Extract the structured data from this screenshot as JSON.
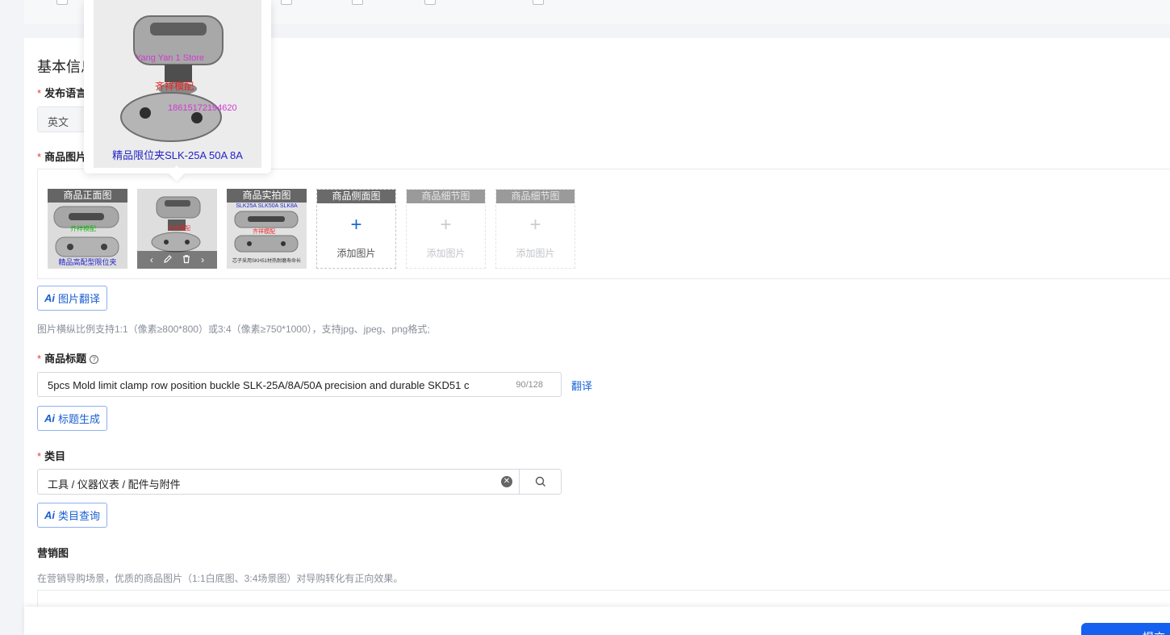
{
  "basic_info": {
    "section_title": "基本信息"
  },
  "language": {
    "label": "发布语言",
    "value": "英文"
  },
  "images": {
    "label": "商品图片",
    "slots": [
      {
        "caption": "商品正面图",
        "filled": true
      },
      {
        "caption": "",
        "filled": true
      },
      {
        "caption": "商品实拍图",
        "filled": true
      },
      {
        "caption": "商品侧面图",
        "filled": false,
        "add_label": "添加图片"
      },
      {
        "caption": "商品细节图",
        "filled": false,
        "add_label": "添加图片"
      },
      {
        "caption": "商品细节图",
        "filled": false,
        "add_label": "添加图片"
      }
    ],
    "thumb1_bottom_text": "精品高配型限位夹",
    "thumb1_mid_text": "齐祥模配",
    "thumb3_top_text": "SLK25A SLK50A SLK8A",
    "thumb3_mid_text": "齐祥模配",
    "thumb3_bottom_text": "芯子采用SKH51材热耐磨寿命长",
    "ai_translate_label": "图片翻译",
    "hint": "图片横纵比例支持1:1（像素≥800*800）或3:4（像素≥750*1000），支持jpg、jpeg、png格式;"
  },
  "preview": {
    "watermark_store": "Yang Yan 1 Store",
    "watermark_brand": "齐祥模配",
    "watermark_phone": "18615172194620",
    "caption": "精品限位夹SLK-25A 50A  8A"
  },
  "title": {
    "label": "商品标题",
    "value": "5pcs  Mold limit clamp row position buckle SLK-25A/8A/50A precision and durable SKD51 c",
    "count": "90/128",
    "translate_link": "翻译",
    "ai_generate_label": "标题生成"
  },
  "category": {
    "label": "类目",
    "value": "工具 / 仪器仪表 / 配件与附件",
    "ai_query_label": "类目查询"
  },
  "marketing": {
    "label": "营销图",
    "hint": "在营销导购场景，优质的商品图片（1:1白底图、3:4场景图）对导购转化有正向效果。"
  },
  "footer": {
    "submit_label": "提交"
  },
  "colors": {
    "primary": "#1560ef",
    "required": "#e23c3c",
    "link": "#1a66d9"
  }
}
